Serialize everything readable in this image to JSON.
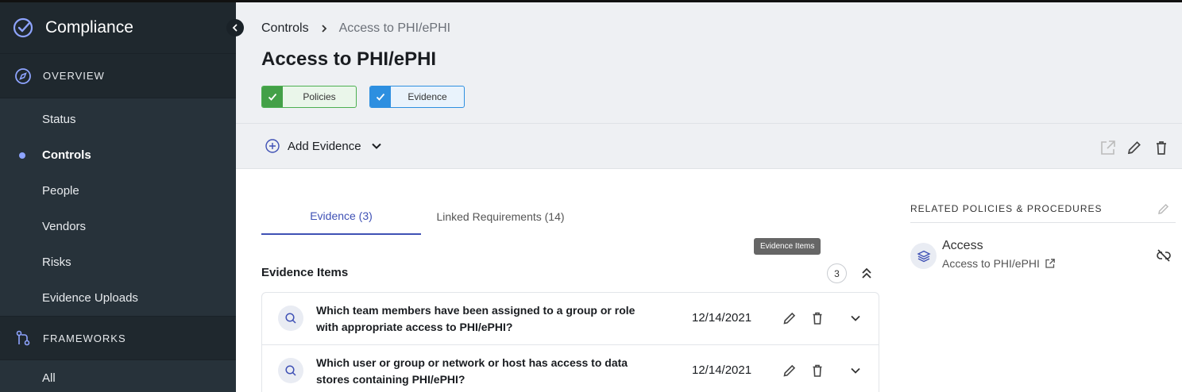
{
  "app": {
    "title": "Compliance"
  },
  "sidebar": {
    "overview_label": "OVERVIEW",
    "items": [
      {
        "label": "Status",
        "active": false
      },
      {
        "label": "Controls",
        "active": true
      },
      {
        "label": "People",
        "active": false
      },
      {
        "label": "Vendors",
        "active": false
      },
      {
        "label": "Risks",
        "active": false
      },
      {
        "label": "Evidence Uploads",
        "active": false
      }
    ],
    "frameworks_label": "FRAMEWORKS",
    "frameworks_items": [
      {
        "label": "All"
      }
    ]
  },
  "breadcrumb": {
    "root": "Controls",
    "current": "Access to PHI/ePHI"
  },
  "page": {
    "title": "Access to PHI/ePHI"
  },
  "chips": {
    "policies": "Policies",
    "evidence": "Evidence"
  },
  "toolbar": {
    "add_evidence": "Add Evidence"
  },
  "tabs": {
    "evidence": "Evidence (3)",
    "linked": "Linked Requirements (14)"
  },
  "tooltip": "Evidence Items",
  "evidence": {
    "title": "Evidence Items",
    "count": "3",
    "items": [
      {
        "question": "Which team members have been assigned to a group or role with appropriate access to PHI/ePHI?",
        "date": "12/14/2021"
      },
      {
        "question": "Which user or group or network or host has access to data stores containing PHI/ePHI?",
        "date": "12/14/2021"
      }
    ]
  },
  "related": {
    "heading": "RELATED POLICIES & PROCEDURES",
    "policy": {
      "name": "Access",
      "subtitle": "Access to PHI/ePHI"
    }
  },
  "colors": {
    "sidebar_bg": "#27323a",
    "accent": "#3f51b5",
    "green": "#43a047",
    "blue": "#2d8fe0"
  }
}
